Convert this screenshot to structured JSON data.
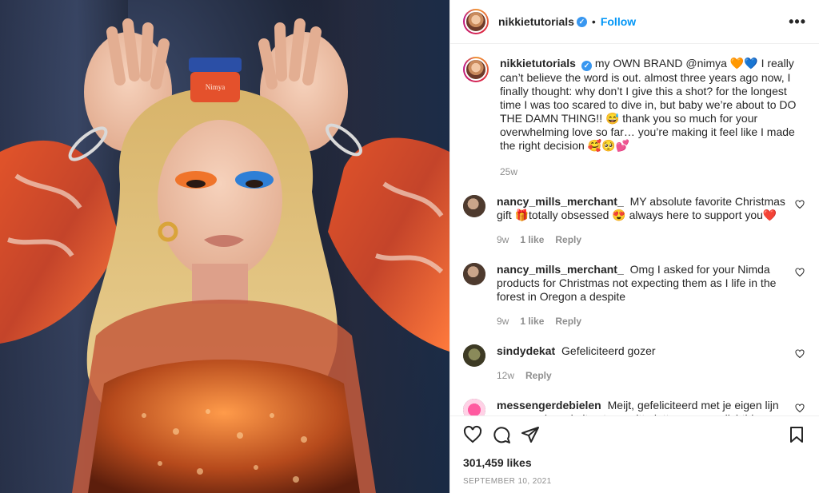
{
  "post": {
    "author": "nikkietutorials",
    "follow_label": "Follow",
    "more_label": "•••",
    "caption_text": "my OWN BRAND @nimya 🧡💙 I really can’t believe the word is out. almost three years ago now, I finally thought: why don’t I give this a shot? for the longest time I was too scared to dive in, but baby we’re about to DO THE DAMN THING!! 😅 thank you so much for your overwhelming love so far… you’re making it feel like I made the right decision 🥰🥺💕",
    "caption_age": "25w",
    "likes": "301,459 likes",
    "date": "SEPTEMBER 10, 2021",
    "product_label": "Nimya"
  },
  "comments": [
    {
      "username": "nancy_mills_merchant_",
      "text": "MY absolute favorite Christmas gift 🎁totally obsessed 😍 always here to support you❤️",
      "age": "9w",
      "likes": "1 like",
      "reply": "Reply"
    },
    {
      "username": "nancy_mills_merchant_",
      "text": "Omg I asked for your Nimda products for Christmas not expecting them as I life in the forest in Oregon a despite",
      "age": "9w",
      "likes": "1 like",
      "reply": "Reply"
    },
    {
      "username": "sindydekat",
      "text": "Gefeliciteerd gozer",
      "age": "12w",
      "reply": "Reply"
    },
    {
      "username": "messengerdebielen",
      "text": "Meijt, gefeliciteerd met je eigen lijn maar op de website staan witte letters op een lichtblauwe"
    }
  ],
  "icons": {
    "like": "heart-icon",
    "comment": "comment-icon",
    "share": "send-icon",
    "save": "bookmark-icon"
  },
  "colors": {
    "accent": "#0095f6",
    "verified": "#3897f0"
  }
}
